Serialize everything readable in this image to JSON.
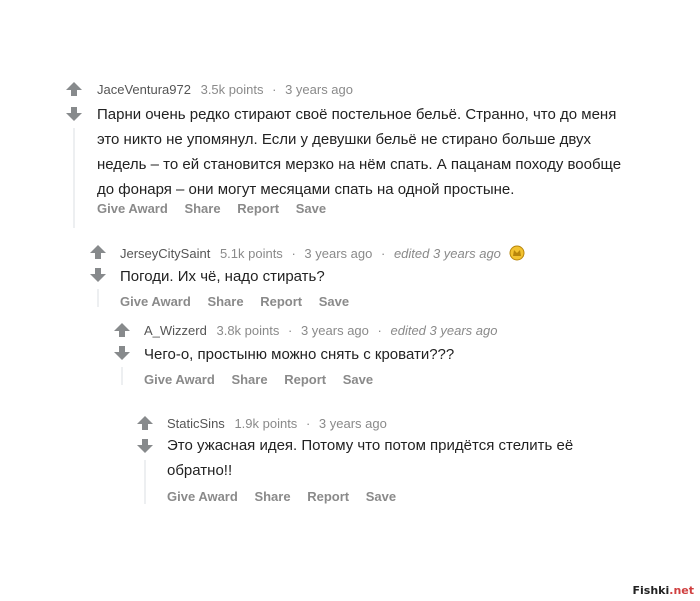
{
  "actions": {
    "give_award": "Give Award",
    "share": "Share",
    "report": "Report",
    "save": "Save"
  },
  "comments": [
    {
      "author": "JaceVentura972",
      "points": "3.5k points",
      "time": "3 years ago",
      "edited": "",
      "lines": [
        "Парни очень редко стирают своё постельное бельё. Странно, что до меня",
        "это никто не упомянул. Если у девушки бельё не стирано больше двух",
        "недель – то ей становится мерзко на нём спать. А пацанам походу вообще",
        "до фонаря – они могут месяцами спать на одной простыне."
      ]
    },
    {
      "author": "JerseyCitySaint",
      "points": "5.1k points",
      "time": "3 years ago",
      "edited": "edited 3 years ago",
      "award_icon": "gold-award-icon",
      "lines": [
        "Погоди. Их чё, надо стирать?"
      ]
    },
    {
      "author": "A_Wizzerd",
      "points": "3.8k points",
      "time": "3 years ago",
      "edited": "edited 3 years ago",
      "lines": [
        "Чего-о, простыню можно снять с кровати???"
      ]
    },
    {
      "author": "StaticSins",
      "points": "1.9k points",
      "time": "3 years ago",
      "edited": "",
      "lines": [
        "Это ужасная идея. Потому что потом придётся стелить её",
        "обратно!!"
      ]
    }
  ],
  "watermark": {
    "part1": "Fishki",
    "part2": ".net"
  },
  "colors": {
    "arrow": "#878a8c",
    "meta": "#8a8a8a",
    "text": "#222222",
    "award": "#e0b400"
  }
}
